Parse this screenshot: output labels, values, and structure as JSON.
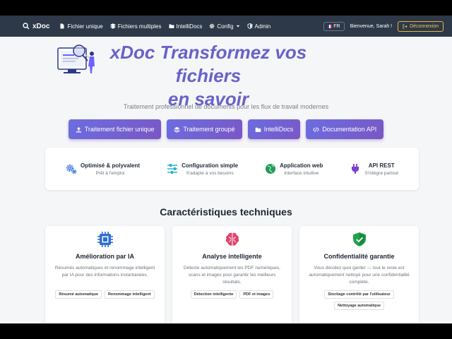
{
  "nav": {
    "brand": "xDoc",
    "items": [
      {
        "label": "Fichier unique",
        "icon": "file-icon"
      },
      {
        "label": "Fichiers multiples",
        "icon": "layers-icon"
      },
      {
        "label": "IntelliDocs",
        "icon": "folder-icon"
      },
      {
        "label": "Config",
        "icon": "gear-icon"
      },
      {
        "label": "Admin",
        "icon": "shield-icon"
      }
    ],
    "lang": "FR",
    "welcome": "Bienvenue, Sarah !",
    "logout": "Déconnexion"
  },
  "hero": {
    "title_line1": "xDoc Transformez vos fichiers",
    "title_line2": "en savoir",
    "subtitle": "Traitement professionnel de documents pour les flux de travail modernes"
  },
  "cta": [
    {
      "label": "Traitement fichier unique",
      "icon": "upload-icon"
    },
    {
      "label": "Traitement groupé",
      "icon": "layers-icon"
    },
    {
      "label": "IntelliDocs",
      "icon": "folder-icon"
    },
    {
      "label": "Documentation API",
      "icon": "code-icon"
    }
  ],
  "features": [
    {
      "title": "Optimisé & polyvalent",
      "sub": "Prêt à l'emploi",
      "icon": "gears-icon",
      "color": "#2f6fd6"
    },
    {
      "title": "Configuration simple",
      "sub": "S'adapte à vos besoins",
      "icon": "sliders-icon",
      "color": "#19b3c4"
    },
    {
      "title": "Application web",
      "sub": "Interface intuitive",
      "icon": "globe-icon",
      "color": "#1f9b55"
    },
    {
      "title": "API REST",
      "sub": "S'intègre partout",
      "icon": "plug-icon",
      "color": "#7b3fd1"
    }
  ],
  "section_title": "Caractéristiques techniques",
  "cards": [
    {
      "title": "Amélioration par IA",
      "desc": "Résumés automatiques et renommage intelligent par IA pour des informations instantanées.",
      "tags": [
        "Résumé automatique",
        "Renommage intelligent"
      ],
      "icon": "chip-icon",
      "color": "#2f6fd6"
    },
    {
      "title": "Analyse intelligente",
      "desc": "Détecte automatiquement les PDF numériques, scans et images pour garantir les meilleurs résultats.",
      "tags": [
        "Détection intelligente",
        "PDF et images"
      ],
      "icon": "brain-icon",
      "color": "#e0456d"
    },
    {
      "title": "Confidentialité garantie",
      "desc": "Vous décidez quoi garder — tout le reste est automatiquement nettoyé pour une confidentialité complète.",
      "tags": [
        "Stockage contrôlé par l'utilisateur",
        "Nettoyage automatique"
      ],
      "icon": "shield-check-icon",
      "color": "#22a04b"
    }
  ]
}
